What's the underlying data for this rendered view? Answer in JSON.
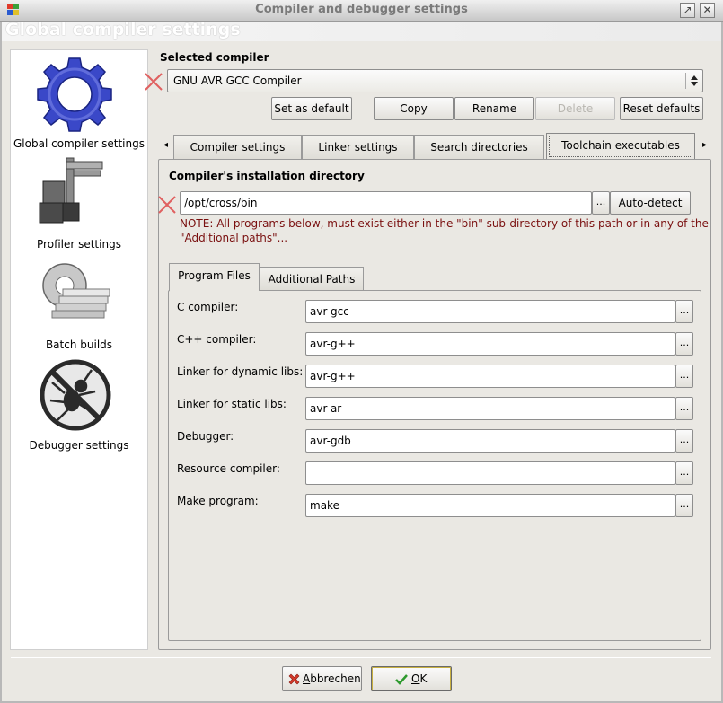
{
  "window": {
    "title": "Compiler and debugger settings",
    "header": "Global compiler settings",
    "minimize_glyph": "↗",
    "close_glyph": "✕"
  },
  "sidebar": {
    "items": [
      {
        "label": "Global compiler settings",
        "icon": "gear-icon"
      },
      {
        "label": "Profiler settings",
        "icon": "caliper-icon"
      },
      {
        "label": "Batch builds",
        "icon": "batch-gear-icon"
      },
      {
        "label": "Debugger settings",
        "icon": "no-bug-icon"
      }
    ]
  },
  "compiler": {
    "section_label": "Selected compiler",
    "selected": "GNU AVR GCC Compiler",
    "buttons": {
      "set_default": "Set as default",
      "copy": "Copy",
      "rename": "Rename",
      "delete": "Delete",
      "reset": "Reset defaults"
    }
  },
  "tabs": {
    "items": [
      "Compiler settings",
      "Linker settings",
      "Search directories",
      "Toolchain executables"
    ],
    "active": "Toolchain executables",
    "left_arrow": "◂",
    "right_arrow": "▸"
  },
  "install": {
    "label": "Compiler's installation directory",
    "path": "/opt/cross/bin",
    "browse": "...",
    "autodetect": "Auto-detect",
    "note_line1": "NOTE: All programs below, must exist either in the \"bin\" sub-directory of this path or in any of the",
    "note_line2": "\"Additional paths\"..."
  },
  "subtabs": {
    "program_files": "Program Files",
    "additional_paths": "Additional Paths"
  },
  "programs": [
    {
      "label": "C compiler:",
      "value": "avr-gcc"
    },
    {
      "label": "C++ compiler:",
      "value": "avr-g++"
    },
    {
      "label": "Linker for dynamic libs:",
      "value": "avr-g++"
    },
    {
      "label": "Linker for static libs:",
      "value": "avr-ar"
    },
    {
      "label": "Debugger:",
      "value": "avr-gdb"
    },
    {
      "label": "Resource compiler:",
      "value": ""
    },
    {
      "label": "Make program:",
      "value": "make"
    }
  ],
  "footer": {
    "cancel_prefix": "",
    "cancel_underline": "A",
    "cancel_rest": "bbrechen",
    "ok_underline": "O",
    "ok_rest": "K"
  },
  "colors": {
    "note": "#7a1010",
    "x_mark": "#e06060",
    "gear_blue": "#3a48c8",
    "ok_check": "#2e9a2e",
    "cancel_x": "#d23a2a"
  }
}
